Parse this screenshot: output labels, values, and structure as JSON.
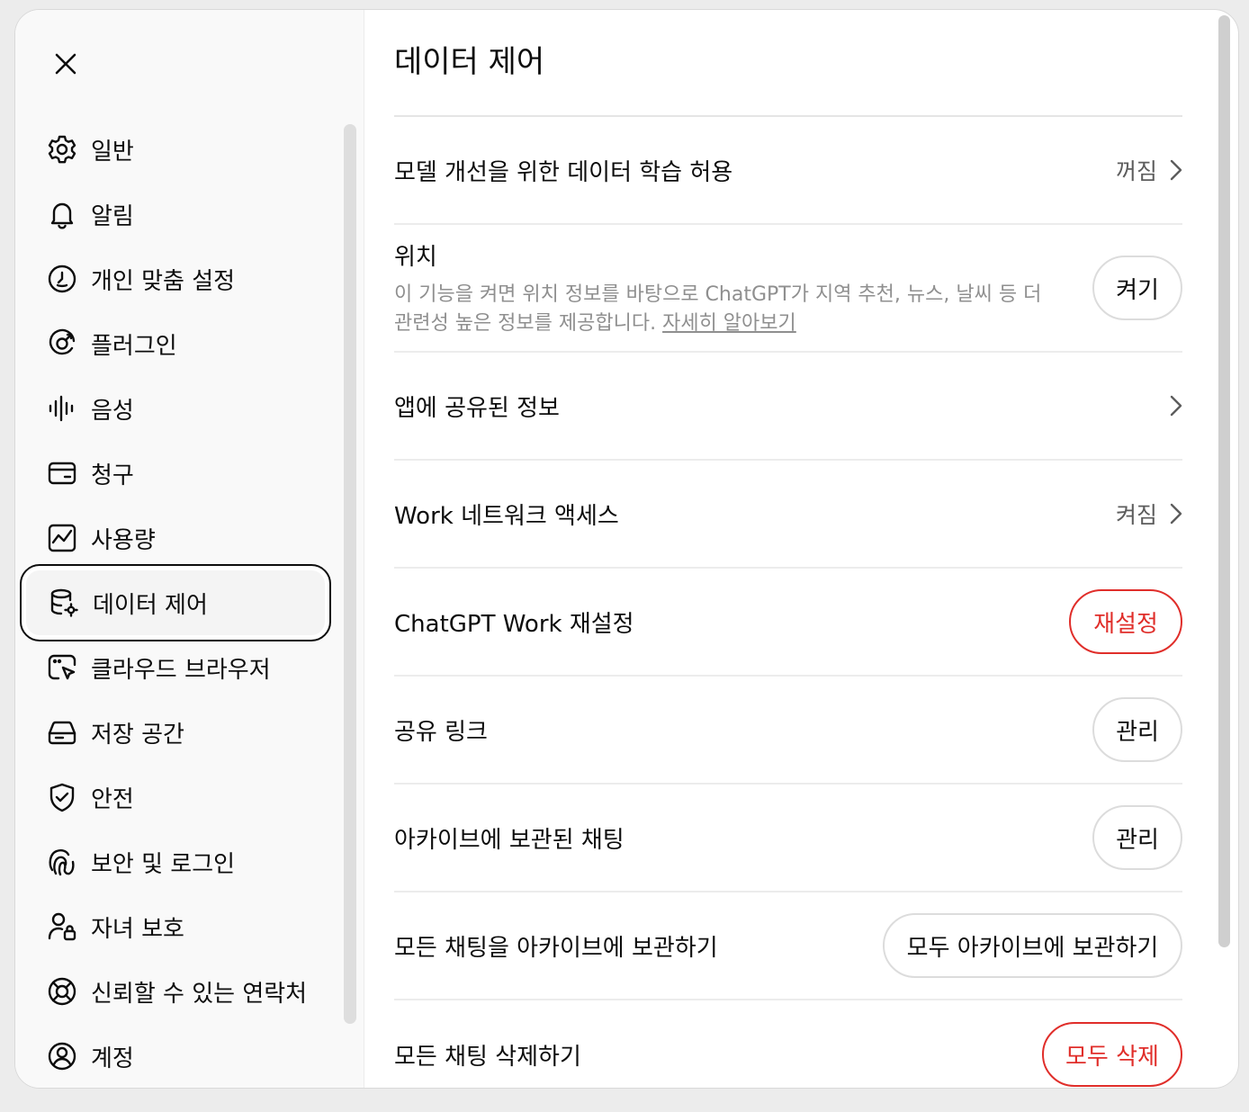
{
  "sidebar": {
    "items": [
      {
        "label": "일반",
        "icon": "gear-icon"
      },
      {
        "label": "알림",
        "icon": "bell-icon"
      },
      {
        "label": "개인 맞춤 설정",
        "icon": "personalization-icon"
      },
      {
        "label": "플러그인",
        "icon": "plugin-icon"
      },
      {
        "label": "음성",
        "icon": "voice-waveform-icon"
      },
      {
        "label": "청구",
        "icon": "credit-card-icon"
      },
      {
        "label": "사용량",
        "icon": "usage-chart-icon"
      },
      {
        "label": "데이터 제어",
        "icon": "database-gear-icon",
        "active": true
      },
      {
        "label": "클라우드 브라우저",
        "icon": "cloud-browser-icon"
      },
      {
        "label": "저장 공간",
        "icon": "storage-drive-icon"
      },
      {
        "label": "안전",
        "icon": "shield-check-icon"
      },
      {
        "label": "보안 및 로그인",
        "icon": "security-login-icon"
      },
      {
        "label": "자녀 보호",
        "icon": "parental-control-icon"
      },
      {
        "label": "신뢰할 수 있는 연락처",
        "icon": "lifebuoy-icon"
      },
      {
        "label": "계정",
        "icon": "account-icon"
      }
    ]
  },
  "main": {
    "title": "데이터 제어",
    "rows": {
      "training": {
        "label": "모델 개선을 위한 데이터 학습 허용",
        "status": "꺼짐"
      },
      "location": {
        "label": "위치",
        "description": "이 기능을 켜면 위치 정보를 바탕으로 ChatGPT가 지역 추천, 뉴스, 날씨 등 더 관련성 높은 정보를 제공합니다.",
        "learn_more": "자세히 알아보기",
        "button": "켜기"
      },
      "shared_apps": {
        "label": "앱에 공유된 정보"
      },
      "work_network": {
        "label": "Work 네트워크 액세스",
        "status": "켜짐"
      },
      "work_reset": {
        "label": "ChatGPT Work 재설정",
        "button": "재설정"
      },
      "shared_links": {
        "label": "공유 링크",
        "button": "관리"
      },
      "archived": {
        "label": "아카이브에 보관된 채팅",
        "button": "관리"
      },
      "archive_all": {
        "label": "모든 채팅을 아카이브에 보관하기",
        "button": "모두 아카이브에 보관하기"
      },
      "delete_all": {
        "label": "모든 채팅 삭제하기",
        "button": "모두 삭제"
      }
    }
  },
  "colors": {
    "danger": "#e02e2a",
    "text": "#0d0d0d",
    "muted": "#8f8f8f",
    "sidebar_bg": "#f9f9f9"
  }
}
